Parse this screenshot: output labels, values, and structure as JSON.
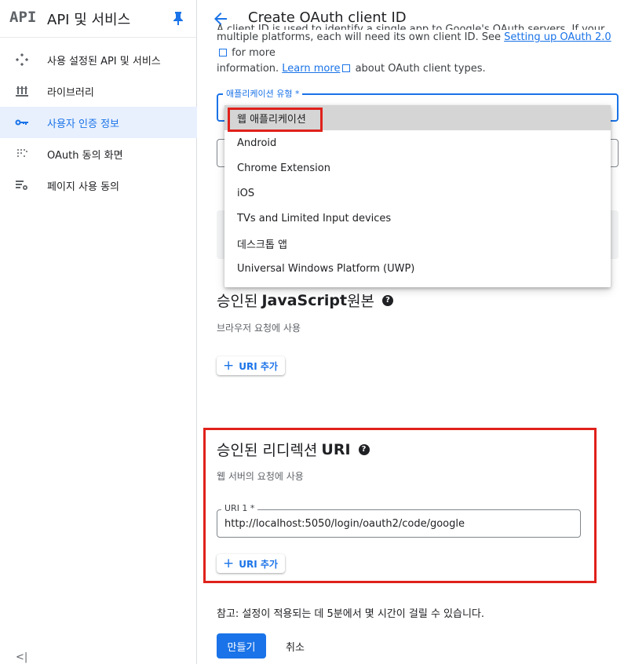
{
  "sidebar": {
    "logo": "API",
    "title": "API 및 서비스",
    "items": [
      {
        "label": "사용 설정된 API 및 서비스"
      },
      {
        "label": "라이브러리"
      },
      {
        "label": "사용자 인증 정보"
      },
      {
        "label": "OAuth 동의 화면"
      },
      {
        "label": "페이지 사용 동의"
      }
    ],
    "collapse": "<|"
  },
  "header": {
    "title": "Create OAuth client ID"
  },
  "intro": {
    "line1": "A client ID is used to identify a single app to Google's OAuth servers. If your app runs on",
    "line2_pre": "multiple platforms, each will need its own client ID. See ",
    "link1": "Setting up OAuth 2.0",
    "line2_post": " for more",
    "line3_pre": "information. ",
    "link2": "Learn more",
    "line3_post": " about OAuth client types."
  },
  "app_type": {
    "label": "애플리케이션 유형 *",
    "options": [
      "웹 애플리케이션",
      "Android",
      "Chrome Extension",
      "iOS",
      "TVs and Limited Input devices",
      "데스크톱 앱",
      "Universal Windows Platform (UWP)"
    ]
  },
  "js_origins": {
    "title_pre": "승인된 ",
    "title_bold": "JavaScript",
    "title_post": " 원본",
    "subtitle": "브라우저 요청에 사용",
    "add_button": "URI 추가"
  },
  "redirect": {
    "title_pre": "승인된 리디렉션 ",
    "title_bold": "URI",
    "subtitle": "웹 서버의 요청에 사용",
    "uri_label": "URI 1 *",
    "uri_value": "http://localhost:5050/login/oauth2/code/google",
    "add_button": "URI 추가"
  },
  "note": "참고: 설정이 적용되는 데 5분에서 몇 시간이 걸릴 수 있습니다.",
  "actions": {
    "create": "만들기",
    "cancel": "취소"
  },
  "colors": {
    "accent": "#1a73e8",
    "highlight": "#e0211b"
  }
}
